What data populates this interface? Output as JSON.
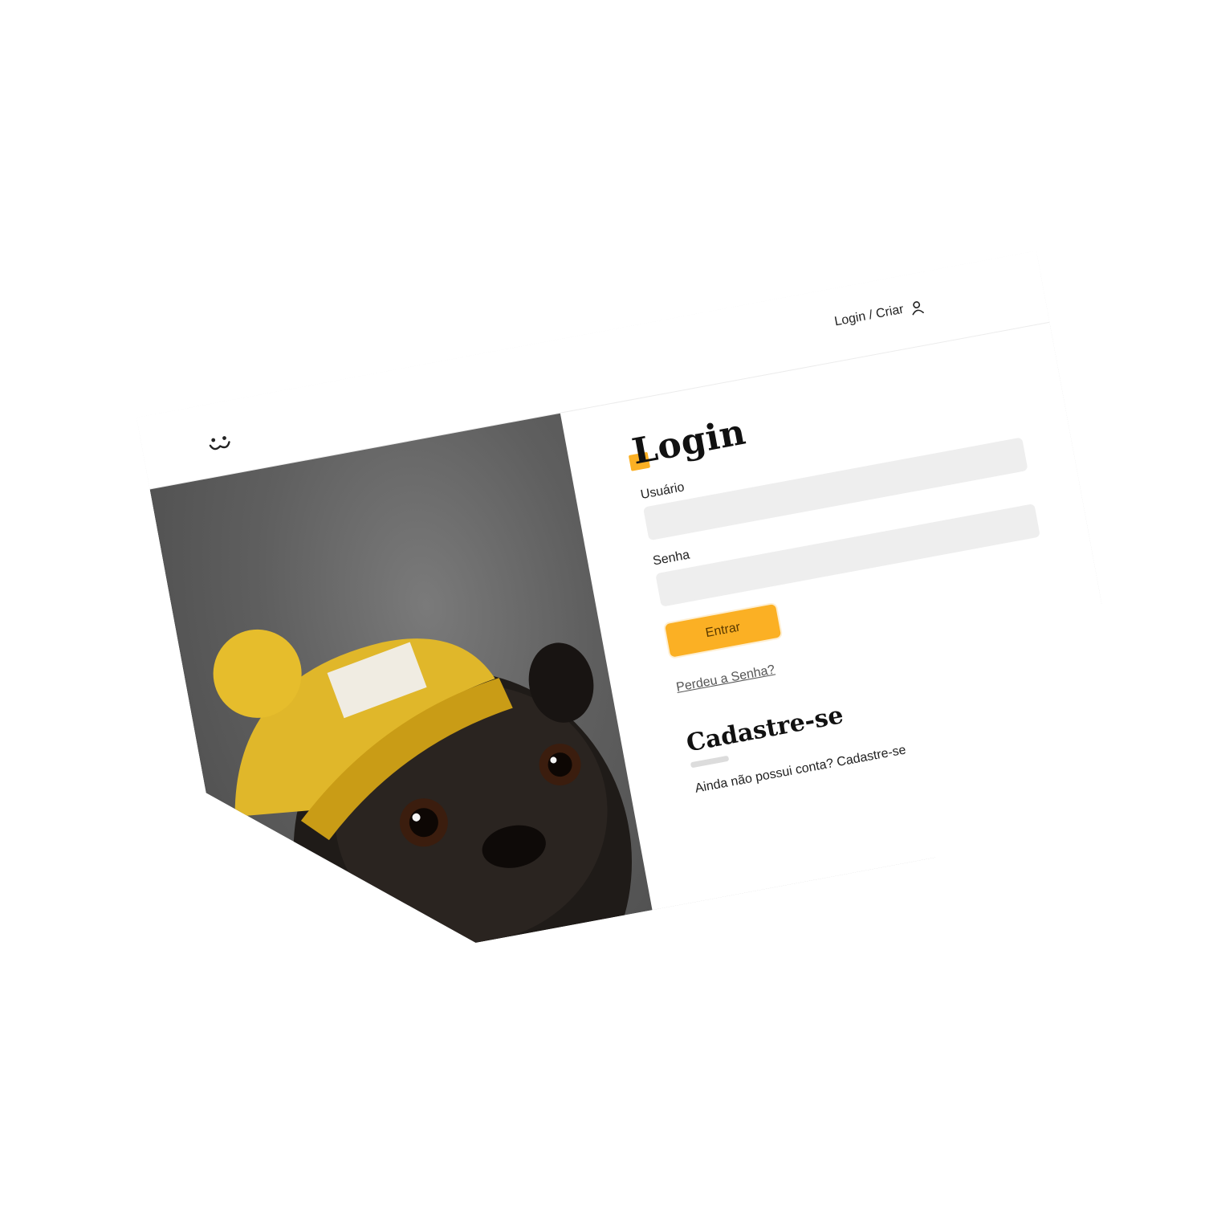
{
  "header": {
    "login_label": "Login / Criar"
  },
  "login": {
    "title": "Login",
    "username_label": "Usuário",
    "password_label": "Senha",
    "submit_label": "Entrar",
    "lost_password": "Perdeu a Senha?"
  },
  "register": {
    "title": "Cadastre-se",
    "text": "Ainda não possui conta? Cadastre-se"
  },
  "colors": {
    "accent": "#fbb024",
    "input_bg": "#eeeeee",
    "text": "#222222"
  },
  "icons": {
    "logo": "dog-face-icon",
    "user": "user-icon"
  }
}
